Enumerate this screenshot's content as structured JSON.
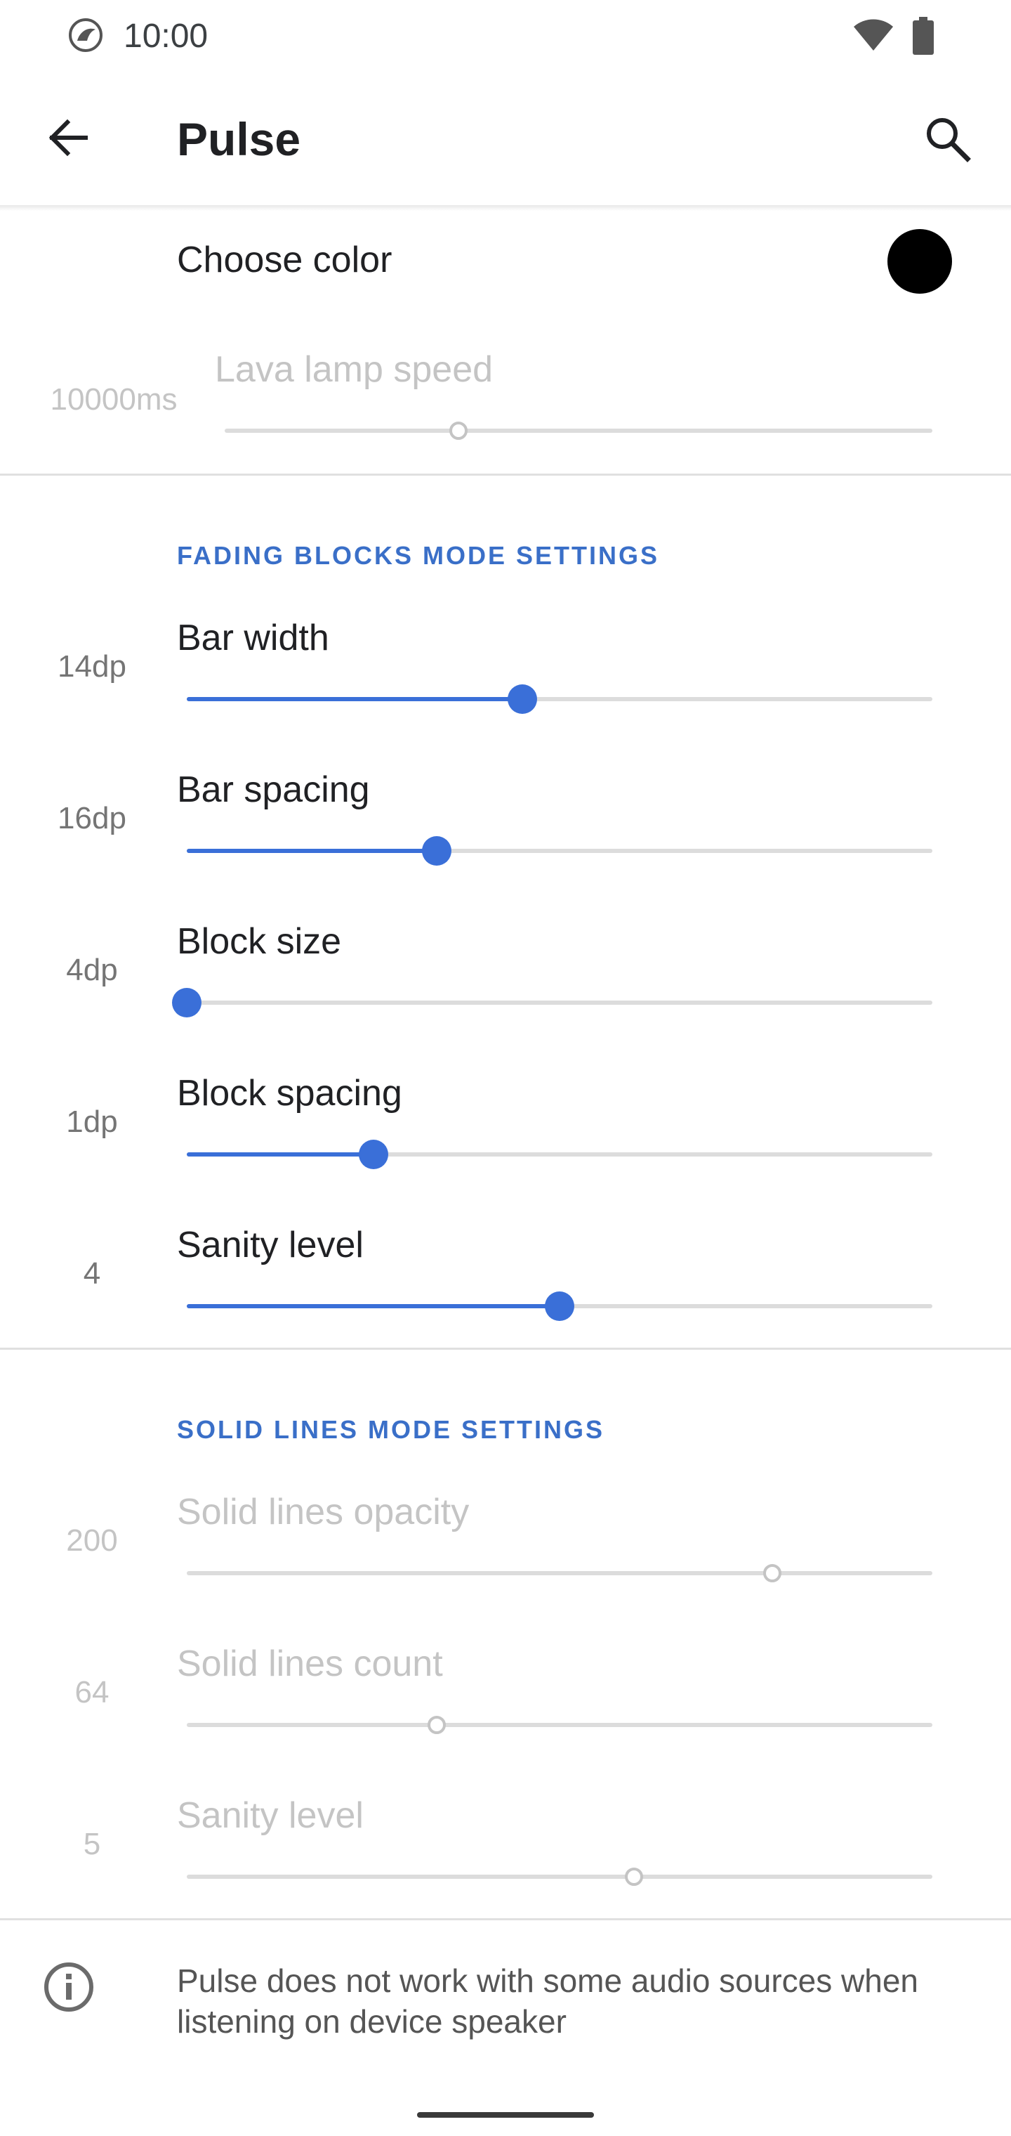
{
  "status_bar": {
    "time": "10:00"
  },
  "app_bar": {
    "title": "Pulse"
  },
  "color_pref": {
    "label": "Choose color",
    "color": "#000000"
  },
  "lava": {
    "label": "Lava lamp speed",
    "value": "10000ms",
    "level": 0.33
  },
  "fading": {
    "header": "FADING BLOCKS MODE SETTINGS",
    "items": [
      {
        "label": "Bar width",
        "value": "14dp",
        "level": 0.45
      },
      {
        "label": "Bar spacing",
        "value": "16dp",
        "level": 0.335
      },
      {
        "label": "Block size",
        "value": "4dp",
        "level": 0.0
      },
      {
        "label": "Block spacing",
        "value": "1dp",
        "level": 0.25
      },
      {
        "label": "Sanity level",
        "value": "4",
        "level": 0.5
      }
    ]
  },
  "solid": {
    "header": "SOLID LINES MODE SETTINGS",
    "items": [
      {
        "label": "Solid lines opacity",
        "value": "200",
        "level": 0.785
      },
      {
        "label": "Solid lines count",
        "value": "64",
        "level": 0.335
      },
      {
        "label": "Sanity level",
        "value": "5",
        "level": 0.6
      }
    ]
  },
  "info": {
    "text": "Pulse does not work with some audio sources when listening on device speaker"
  },
  "colors": {
    "accent": "#3a6fd8",
    "disabled": "#c4c4c4"
  },
  "icons": [
    "logo-icon",
    "wifi-icon",
    "battery-icon",
    "back-arrow-icon",
    "search-icon",
    "info-icon"
  ]
}
